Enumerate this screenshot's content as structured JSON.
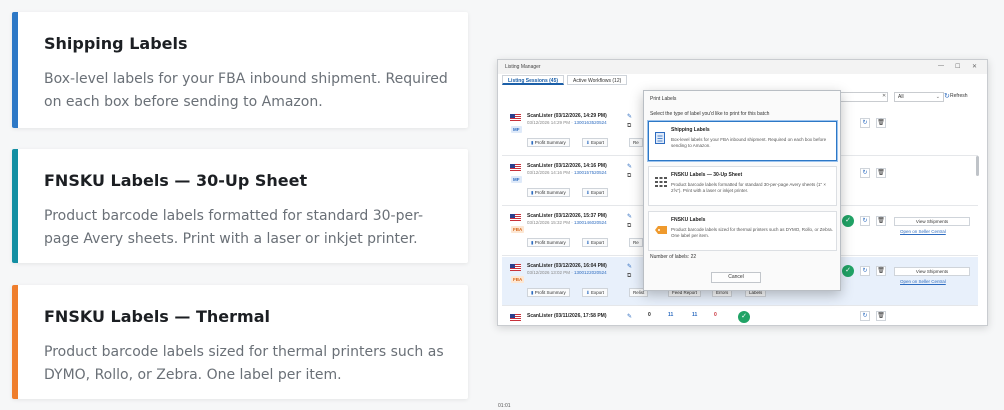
{
  "cards": [
    {
      "title": "Shipping Labels",
      "description": "Box-level labels for your FBA inbound shipment. Required on each box before sending to Amazon.",
      "accent": "#2d78c6"
    },
    {
      "title": "FNSKU Labels — 30-Up Sheet",
      "description": "Product barcode labels formatted for standard 30-per-page Avery sheets. Print with a laser or inkjet printer.",
      "accent": "#138fa3"
    },
    {
      "title": "FNSKU Labels — Thermal",
      "description": "Product barcode labels sized for thermal printers such as DYMO, Rollo, or Zebra. One label per item.",
      "accent": "#ef7e2d"
    }
  ],
  "window": {
    "title": "Listing Manager",
    "tabs": [
      "Listing Sessions (45)",
      "Active Workflows (12)"
    ],
    "filter_value": "All",
    "refresh_label": "Refresh",
    "rows": [
      {
        "name": "ScanLister (03/12/2026, 14:29 PM)",
        "date": "03/12/2026 14:29 PM",
        "id": "1300163520524",
        "badge": "MF",
        "profile": "Profit Summary",
        "export": "Export",
        "partial": "Re"
      },
      {
        "name": "ScanLister (03/12/2026, 14:16 PM)",
        "date": "03/12/2026 14:16 PM",
        "id": "1300157520524",
        "badge": "MF",
        "profile": "Profit Summary",
        "export": "Export"
      },
      {
        "name": "ScanLister (03/12/2026, 15:37 PM)",
        "date": "03/12/2026 15:32 PM",
        "id": "1300146020524",
        "badge": "FBA",
        "profile": "Profit Summary",
        "export": "Export",
        "partial": "Re",
        "view": "View Shipments",
        "link": "Open on Seller Central"
      },
      {
        "name": "ScanLister (03/12/2026, 16:04 PM)",
        "date": "03/12/2026 13:02 PM",
        "id": "1300122020524",
        "badge": "FBA",
        "profile": "Profit Summary",
        "export": "Export",
        "relist": "Relist",
        "feed": "Feed Report",
        "errors": "Errors",
        "labels": "Labels",
        "view": "View Shipments",
        "link": "Open on Seller Central"
      },
      {
        "name": "ScanLister (03/11/2026, 17:58 PM)",
        "numbers": [
          "0",
          "11",
          "11",
          "0"
        ]
      }
    ]
  },
  "dialog": {
    "title": "Print Labels",
    "prompt": "Select the type of label you'd like to print for this batch",
    "options": [
      {
        "title": "Shipping Labels",
        "description": "Box-level labels for your FBA inbound shipment. Required on each box before sending to Amazon.",
        "icon": "document-icon"
      },
      {
        "title": "FNSKU Labels — 30-Up Sheet",
        "description": "Product barcode labels formatted for standard 30-per-page Avery sheets (1\" × 2⅝\"). Print with a laser or inkjet printer.",
        "icon": "grid-icon"
      },
      {
        "title": "FNSKU Labels",
        "description": "Product barcode labels sized for thermal printers such as DYMO, Rollo, or Zebra. One label per item.",
        "icon": "tag-icon"
      }
    ],
    "count_label": "Number of labels: 22",
    "cancel_label": "Cancel"
  },
  "footer_text": "01:01"
}
